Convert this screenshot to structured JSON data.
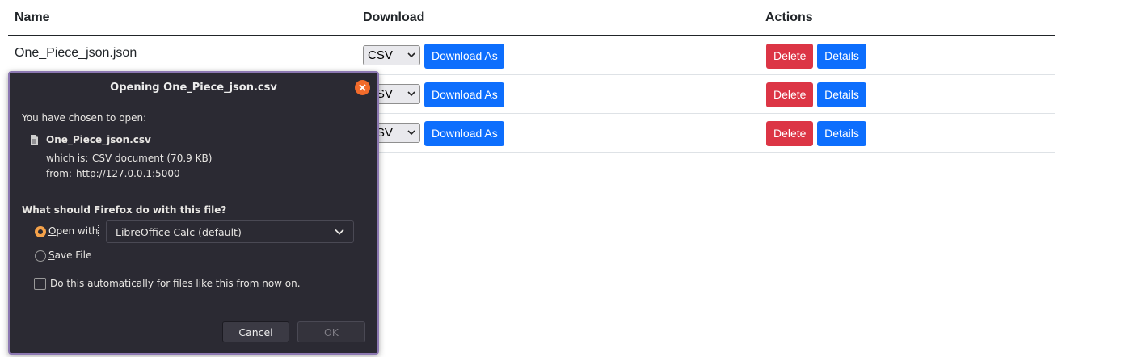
{
  "table": {
    "headers": {
      "name": "Name",
      "download": "Download",
      "actions": "Actions"
    },
    "rows": [
      {
        "name": "One_Piece_json.json",
        "format": "CSV",
        "download_label": "Download As",
        "delete_label": "Delete",
        "details_label": "Details"
      },
      {
        "name": "",
        "format": "CSV",
        "download_label": "Download As",
        "delete_label": "Delete",
        "details_label": "Details"
      },
      {
        "name": "",
        "format": "CSV",
        "download_label": "Download As",
        "delete_label": "Delete",
        "details_label": "Details"
      }
    ]
  },
  "dialog": {
    "title": "Opening One_Piece_json.csv",
    "intro": "You have chosen to open:",
    "file_name": "One_Piece_json.csv",
    "which_is_label": "which is:",
    "which_is_value": "CSV document (70.9 KB)",
    "from_label": "from:",
    "from_value": "http://127.0.0.1:5000",
    "question": "What should Firefox do with this file?",
    "open_with_label": "Open with",
    "open_with_app": "LibreOffice Calc (default)",
    "save_file_label": "Save File",
    "auto_label": "Do this automatically for files like this from now on.",
    "cancel_label": "Cancel",
    "ok_label": "OK",
    "selected_option": "open_with",
    "auto_checked": false
  },
  "colors": {
    "primary": "#0d6efd",
    "danger": "#dc3545",
    "dialog_bg": "#2b2a33",
    "dialog_border": "#8c78b2",
    "close_button": "#f26b2b",
    "radio_checked": "#f5a24a"
  },
  "icons": [
    "chevron-down-icon",
    "close-icon",
    "file-icon"
  ]
}
